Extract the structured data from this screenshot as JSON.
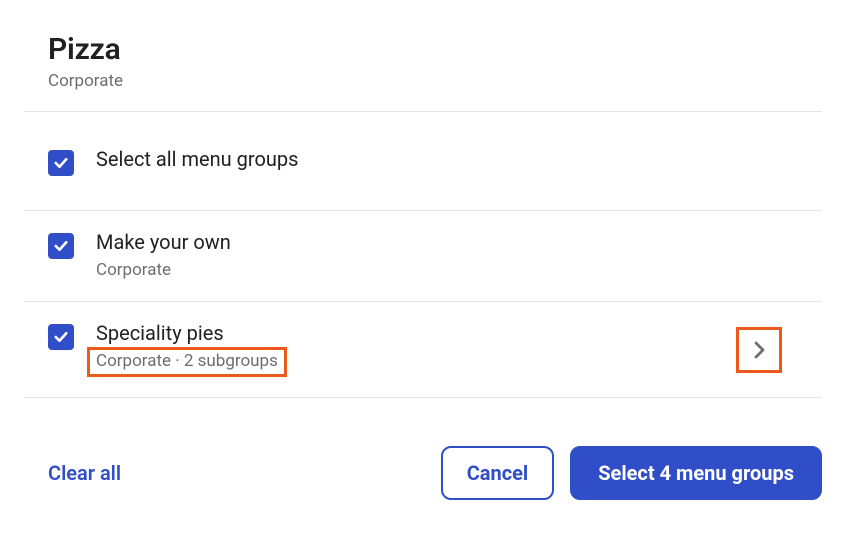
{
  "header": {
    "title": "Pizza",
    "subtitle": "Corporate"
  },
  "selectAll": {
    "label": "Select all menu groups"
  },
  "items": [
    {
      "label": "Make your own",
      "sub": "Corporate",
      "highlight": false,
      "chevron": false
    },
    {
      "label": "Speciality pies",
      "sub": "Corporate · 2 subgroups",
      "highlight": true,
      "chevron": true
    }
  ],
  "actions": {
    "clear": "Clear all",
    "cancel": "Cancel",
    "select": "Select 4 menu groups"
  }
}
